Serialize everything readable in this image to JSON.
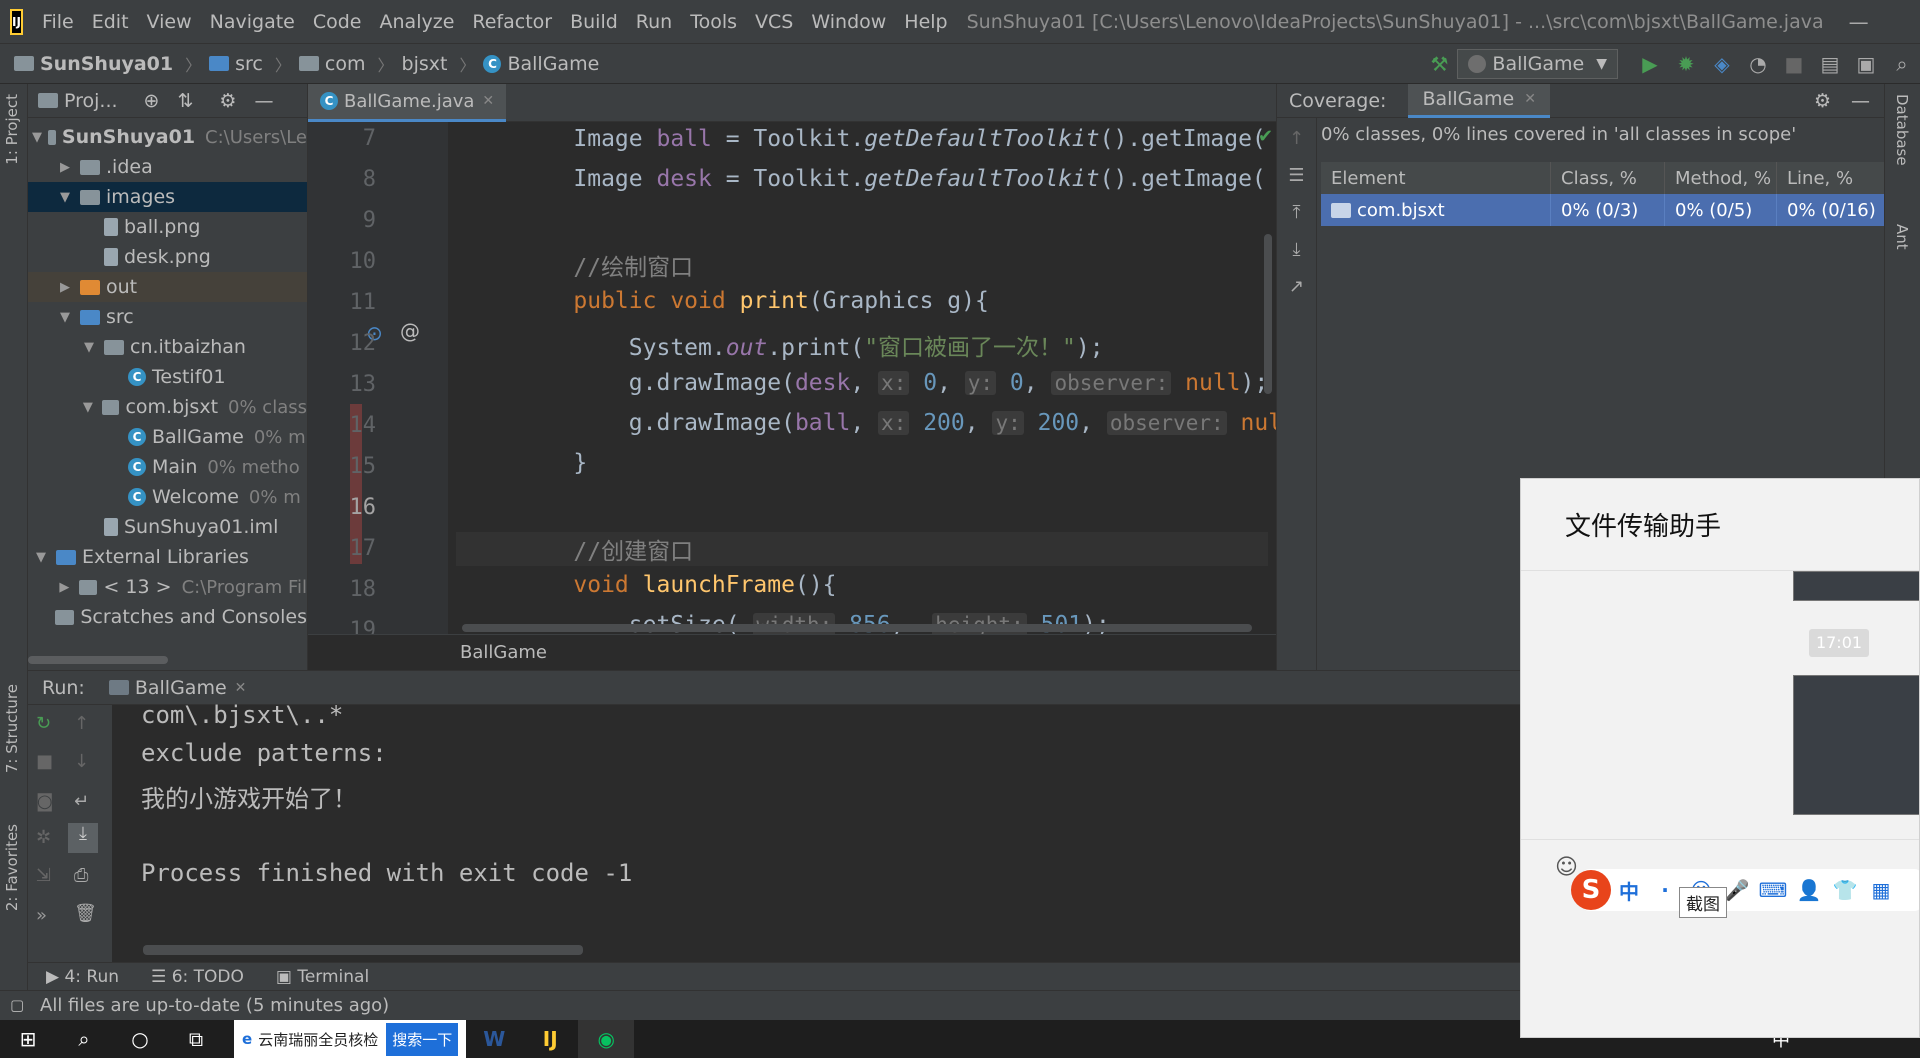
{
  "app": {
    "logo_text": "IJ",
    "menu": [
      "File",
      "Edit",
      "View",
      "Navigate",
      "Code",
      "Analyze",
      "Refactor",
      "Build",
      "Run",
      "Tools",
      "VCS",
      "Window",
      "Help"
    ],
    "window_title": "SunShuya01 [C:\\Users\\Lenovo\\IdeaProjects\\SunShuya01] - ...\\src\\com\\bjsxt\\BallGame.java",
    "window_controls": [
      "—",
      "❐",
      "✕"
    ]
  },
  "breadcrumbs": [
    "SunShuya01",
    "src",
    "com",
    "bjsxt",
    "BallGame"
  ],
  "run_config": "BallGame",
  "left_tabs": [
    "1: Project",
    "7: Structure",
    "2: Favorites"
  ],
  "right_tabs": [
    "Database",
    "Ant"
  ],
  "project": {
    "header": "Proj...",
    "tree": [
      {
        "label": "SunShuya01",
        "hint": "C:\\Users\\Le",
        "arrow": "▼",
        "indent": 0,
        "icon": "folder",
        "bold": true
      },
      {
        "label": ".idea",
        "arrow": "▶",
        "indent": 1,
        "icon": "folder"
      },
      {
        "label": "images",
        "arrow": "▼",
        "indent": 1,
        "icon": "folder",
        "selected": true
      },
      {
        "label": "ball.png",
        "arrow": "",
        "indent": 2,
        "icon": "file"
      },
      {
        "label": "desk.png",
        "arrow": "",
        "indent": 2,
        "icon": "file"
      },
      {
        "label": "out",
        "arrow": "▶",
        "indent": 1,
        "icon": "folder-orange",
        "highlight": true
      },
      {
        "label": "src",
        "arrow": "▼",
        "indent": 1,
        "icon": "folder-blue"
      },
      {
        "label": "cn.itbaizhan",
        "arrow": "▼",
        "indent": 2,
        "icon": "package"
      },
      {
        "label": "Testif01",
        "arrow": "",
        "indent": 3,
        "icon": "class"
      },
      {
        "label": "com.bjsxt",
        "hint": "0% class",
        "arrow": "▼",
        "indent": 2,
        "icon": "package"
      },
      {
        "label": "BallGame",
        "hint": "0% m",
        "arrow": "",
        "indent": 3,
        "icon": "class"
      },
      {
        "label": "Main",
        "hint": "0% metho",
        "arrow": "",
        "indent": 3,
        "icon": "class"
      },
      {
        "label": "Welcome",
        "hint": "0% m",
        "arrow": "",
        "indent": 3,
        "icon": "class"
      },
      {
        "label": "SunShuya01.iml",
        "arrow": "",
        "indent": 2,
        "icon": "file"
      },
      {
        "label": "External Libraries",
        "arrow": "▼",
        "indent": 0,
        "icon": "lib"
      },
      {
        "label": "< 13 >",
        "hint": "C:\\Program Fil",
        "arrow": "▶",
        "indent": 1,
        "icon": "folder"
      },
      {
        "label": "Scratches and Consoles",
        "arrow": "",
        "indent": 0,
        "icon": "scratch"
      }
    ]
  },
  "editor": {
    "tab": "BallGame.java",
    "footer_label": "BallGame",
    "line_numbers": [
      "7",
      "8",
      "9",
      "10",
      "11",
      "12",
      "13",
      "14",
      "15",
      "16",
      "17",
      "18",
      "19"
    ]
  },
  "coverage": {
    "label": "Coverage:",
    "tab": "BallGame",
    "summary": "0% classes, 0% lines covered in 'all classes in scope'",
    "columns": [
      "Element",
      "Class, %",
      "Method, %",
      "Line, %"
    ],
    "rows": [
      {
        "element": "com.bjsxt",
        "class": "0% (0/3)",
        "method": "0% (0/5)",
        "line": "0% (0/16)"
      }
    ]
  },
  "run": {
    "label": "Run:",
    "tab": "BallGame",
    "console": [
      "com\\.bjsxt\\..*",
      "exclude patterns:",
      "我的小游戏开始了！",
      "",
      "Process finished with exit code -1"
    ]
  },
  "bottom_tabs": [
    "4: Run",
    "6: TODO",
    "Terminal"
  ],
  "status": "All files are up-to-date (5 minutes ago)",
  "wechat": {
    "title": "文件传输助手",
    "time": "17:01",
    "ime_logo": "S",
    "ime_items": [
      "中",
      "·",
      "☺",
      "🎤",
      "⌨",
      "👤",
      "👕",
      "▦"
    ],
    "tooltip": "截图"
  },
  "taskbar": {
    "app_text": "云南瑞丽全员核检",
    "app_button": "搜索一下",
    "tray_lang": "中"
  }
}
